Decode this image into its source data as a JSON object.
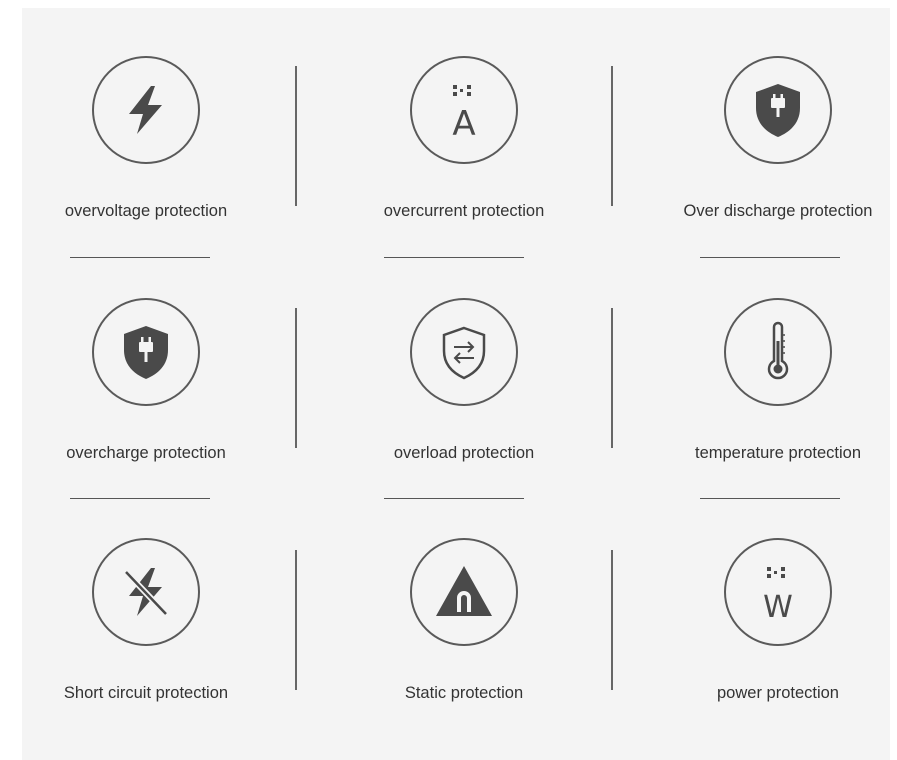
{
  "features": [
    {
      "id": "overvoltage",
      "label": "overvoltage protection",
      "icon": "lightning-bolt-icon"
    },
    {
      "id": "overcurrent",
      "label": "overcurrent protection",
      "icon": "ampere-icon",
      "glyph": "A"
    },
    {
      "id": "over-discharge",
      "label": "Over discharge protection",
      "icon": "shield-plug-icon"
    },
    {
      "id": "overcharge",
      "label": "overcharge protection",
      "icon": "shield-plug-icon"
    },
    {
      "id": "overload",
      "label": "overload protection",
      "icon": "shield-arrows-icon"
    },
    {
      "id": "temperature",
      "label": "temperature protection",
      "icon": "thermometer-icon"
    },
    {
      "id": "short-circuit",
      "label": "Short circuit protection",
      "icon": "crossed-lightning-icon"
    },
    {
      "id": "static",
      "label": "Static protection",
      "icon": "triangle-magnet-icon"
    },
    {
      "id": "power",
      "label": "power protection",
      "icon": "watt-icon",
      "glyph": "W"
    }
  ],
  "colors": {
    "background": "#f4f4f4",
    "icon": "#4a4a4a",
    "text": "#333333"
  }
}
